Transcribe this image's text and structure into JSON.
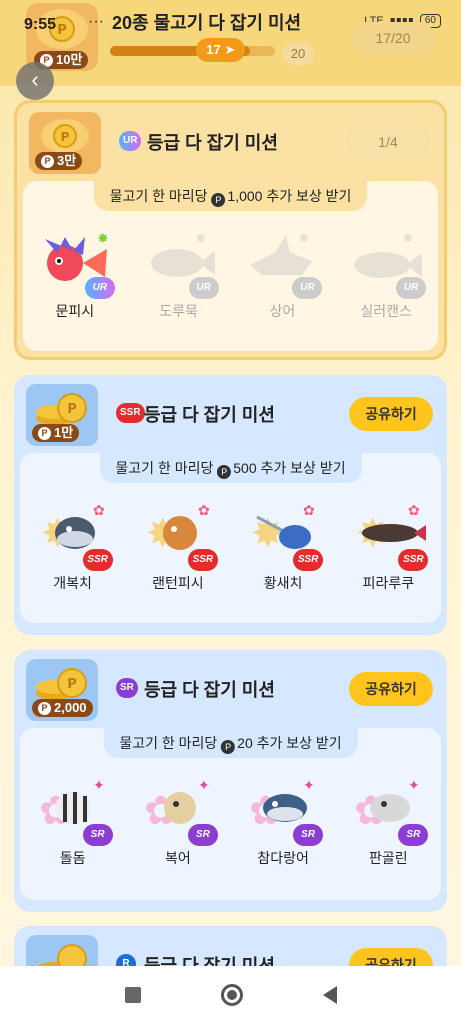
{
  "status": {
    "time": "9:55",
    "dots": "···",
    "network": "LTE",
    "battery": "60"
  },
  "hero": {
    "reward": "10만",
    "title": "20종 물고기 다 잡기 미션",
    "progress_current": "17",
    "progress_max": "20",
    "progress_fraction": 0.85,
    "count": "17/20"
  },
  "back": {
    "label": "‹"
  },
  "ur": {
    "reward": "3만",
    "rank": "UR",
    "title": "등급 다 잡기 미션",
    "count": "1/4",
    "reward_text": "물고기 한 마리당",
    "reward_amount": "1,000 추가 보상 받기",
    "fish": [
      {
        "name": "문피시",
        "tag": "UR",
        "caught": true
      },
      {
        "name": "도루묵",
        "tag": "UR",
        "caught": false
      },
      {
        "name": "상어",
        "tag": "UR",
        "caught": false
      },
      {
        "name": "실러캔스",
        "tag": "UR",
        "caught": false
      }
    ]
  },
  "ssr": {
    "reward": "1만",
    "rank": "SSR",
    "title": "등급 다 잡기 미션",
    "share": "공유하기",
    "reward_text": "물고기 한 마리당",
    "reward_amount": "500 추가 보상 받기",
    "fish": [
      {
        "name": "개복치",
        "tag": "SSR"
      },
      {
        "name": "랜턴피시",
        "tag": "SSR"
      },
      {
        "name": "황새치",
        "tag": "SSR"
      },
      {
        "name": "피라루쿠",
        "tag": "SSR"
      }
    ]
  },
  "sr": {
    "reward": "2,000",
    "rank": "SR",
    "title": "등급 다 잡기 미션",
    "share": "공유하기",
    "reward_text": "물고기 한 마리당",
    "reward_amount": "20 추가 보상 받기",
    "fish": [
      {
        "name": "돌돔",
        "tag": "SR"
      },
      {
        "name": "복어",
        "tag": "SR"
      },
      {
        "name": "참다랑어",
        "tag": "SR"
      },
      {
        "name": "판골린",
        "tag": "SR"
      }
    ]
  },
  "r": {
    "rank": "R",
    "title": "등급 다 잡기 미션",
    "share": "공유하기"
  },
  "colors": {
    "gold": "#ffc51c",
    "ur_bg": "#fbe1a3",
    "ssr_tag": "#e62b2b",
    "sr_tag": "#8c3dd6",
    "r_tag": "#1f6ed8"
  }
}
